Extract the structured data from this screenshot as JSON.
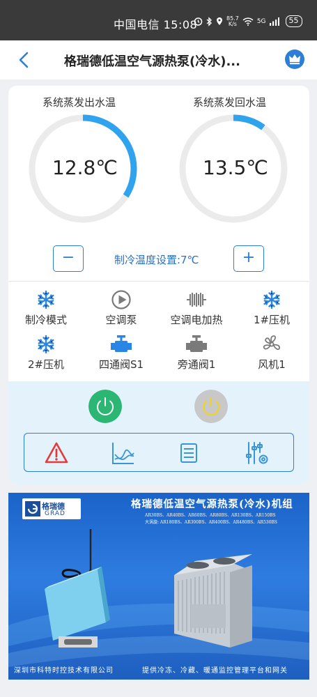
{
  "status_bar": {
    "carrier_time": "中国电信 15:08",
    "net_speed_value": "85.7",
    "net_speed_unit": "K/s",
    "signal": "5G",
    "battery": "55"
  },
  "header": {
    "title": "格瑞德低温空气源热泵(冷水)..."
  },
  "gauges": [
    {
      "label": "系统蒸发出水温",
      "value": "12.8℃",
      "fill_fraction": 0.34,
      "track_color": "#ebebeb",
      "fill_color": "#2fa3ee"
    },
    {
      "label": "系统蒸发回水温",
      "value": "13.5℃",
      "fill_fraction": 0.1,
      "track_color": "#ebebeb",
      "fill_color": "#2fa3ee"
    }
  ],
  "setpoint": {
    "decrease_label": "−",
    "increase_label": "+",
    "text": "制冷温度设置:7℃"
  },
  "status_items": [
    {
      "label": "制冷模式",
      "icon": "snowflake-icon",
      "active": true
    },
    {
      "label": "空调泵",
      "icon": "pump-icon",
      "active": false
    },
    {
      "label": "空调电加热",
      "icon": "heater-icon",
      "active": false
    },
    {
      "label": "1#压机",
      "icon": "snowflake-icon",
      "active": true
    },
    {
      "label": "2#压机",
      "icon": "snowflake-icon",
      "active": true
    },
    {
      "label": "四通阀S1",
      "icon": "valve-icon",
      "active": true
    },
    {
      "label": "旁通阀1",
      "icon": "valve-icon",
      "active": false
    },
    {
      "label": "风机1",
      "icon": "fan-icon",
      "active": false
    }
  ],
  "power_buttons": [
    {
      "name": "power-on-button",
      "color": "#2bb673"
    },
    {
      "name": "power-off-button",
      "color": "#c8c8c8"
    }
  ],
  "toolbar": [
    "alarm-icon",
    "trend-chart-icon",
    "list-icon",
    "settings-sliders-icon"
  ],
  "banner": {
    "logo_text": "格瑞德",
    "logo_sub": "GRAD",
    "title": "格瑞德低温空气源热泵(冷水)机组",
    "models_line1": "AR30BS、AR40BS、AR60BS、AR80BS、AR130BS、AR150BS",
    "models_line2": "大涡旋: AR180BS、AR300BS、AR400BS、AR480BS、AR530BS",
    "footer_left": "深圳市科特时控技术有限公司",
    "footer_right": "提供冷冻、冷藏、暖通监控管理平台和网关"
  },
  "colors": {
    "accent": "#2b7fd6",
    "icon_blue": "#2a86e6",
    "icon_gray": "#7a7a7a"
  }
}
